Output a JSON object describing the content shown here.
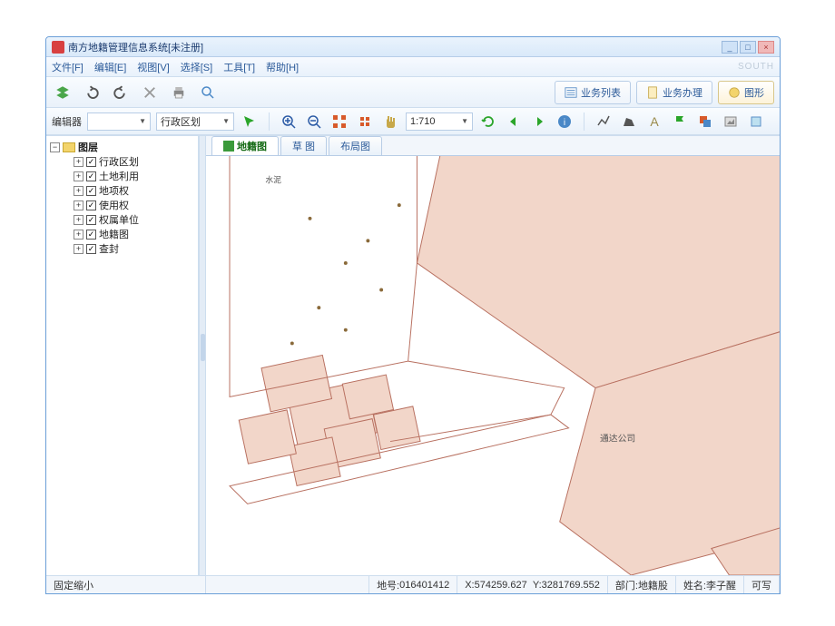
{
  "window": {
    "title": "南方地籍管理信息系统[未注册]"
  },
  "menubar": {
    "items": [
      "文件[F]",
      "编辑[E]",
      "视图[V]",
      "选择[S]",
      "工具[T]",
      "帮助[H]"
    ],
    "brand": "SOUTH"
  },
  "toolbar1": {
    "right_tabs": [
      {
        "label": "业务列表",
        "active": false
      },
      {
        "label": "业务办理",
        "active": false
      },
      {
        "label": "图形",
        "active": true
      }
    ]
  },
  "toolbar2": {
    "editor_label": "编辑器",
    "layer_combo": "行政区划",
    "scale_value": "1:710"
  },
  "tree": {
    "root": "图层",
    "items": [
      {
        "label": "行政区划",
        "checked": true
      },
      {
        "label": "土地利用",
        "checked": true
      },
      {
        "label": "地项权",
        "checked": true
      },
      {
        "label": "使用权",
        "checked": true
      },
      {
        "label": "权属单位",
        "checked": true
      },
      {
        "label": "地籍图",
        "checked": true
      },
      {
        "label": "查封",
        "checked": true
      }
    ]
  },
  "maptabs": [
    {
      "label": "地籍图",
      "active": true
    },
    {
      "label": "草  图",
      "active": false
    },
    {
      "label": "布局图",
      "active": false
    }
  ],
  "map_labels": {
    "area_label": "通达公司",
    "small_label": "水泥"
  },
  "statusbar": {
    "left": "固定缩小",
    "parcel_no_label": "地号:",
    "parcel_no": "016401412",
    "coord_x_label": "X:",
    "coord_x": "574259.627",
    "coord_y_label": "Y:",
    "coord_y": "3281769.552",
    "dept_label": "部门:",
    "dept": "地籍股",
    "user_label": "姓名:",
    "user": "李子醒",
    "writable": "可写"
  }
}
